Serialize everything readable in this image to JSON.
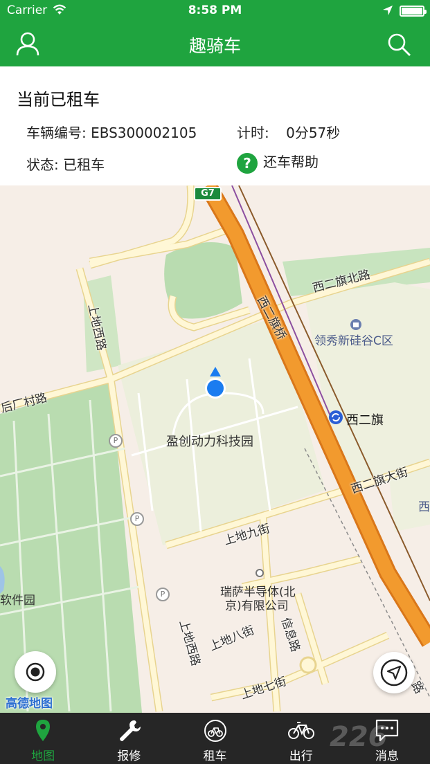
{
  "status_bar": {
    "carrier": "Carrier",
    "time": "8:58 PM"
  },
  "nav": {
    "title": "趣骑车",
    "left_icon": "user-icon",
    "right_icon": "search-icon"
  },
  "rental": {
    "heading": "当前已租车",
    "bike_id_label": "车辆编号:",
    "bike_id": "EBS300002105",
    "timer_label": "计时:",
    "timer_value": "0分57秒",
    "status_label": "状态:",
    "status_value": "已租车",
    "help_label": "还车帮助"
  },
  "map": {
    "highway_shield": "G7",
    "poi": [
      "领秀新硅谷C区",
      "西二旗",
      "盈创动力科技园",
      "瑞萨半导体(北",
      "京)有限公司",
      "软件园",
      "西"
    ],
    "roads": [
      "西二旗北路",
      "西二旗桥",
      "上地西路",
      "后厂村路",
      "西二旗大街",
      "上地九街",
      "上地八街",
      "信息路",
      "上地七街",
      "上地西路",
      "路"
    ],
    "provider": "高德地图",
    "colors": {
      "park": "#b9dcb0",
      "campus": "#ecefdc",
      "road": "#fff7d6",
      "road_edge": "#e8d48f",
      "highway": "#f29a2e",
      "highway_edge": "#d9771a",
      "bg": "#f6eee7",
      "location": "#1a7cf0"
    }
  },
  "tabs": [
    {
      "label": "地图",
      "icon": "map-pin-icon",
      "active": true
    },
    {
      "label": "报修",
      "icon": "wrench-icon",
      "active": false
    },
    {
      "label": "租车",
      "icon": "rent-bike-icon",
      "active": false
    },
    {
      "label": "出行",
      "icon": "bicycle-icon",
      "active": false
    },
    {
      "label": "消息",
      "icon": "message-icon",
      "active": false
    }
  ],
  "watermark": "226"
}
